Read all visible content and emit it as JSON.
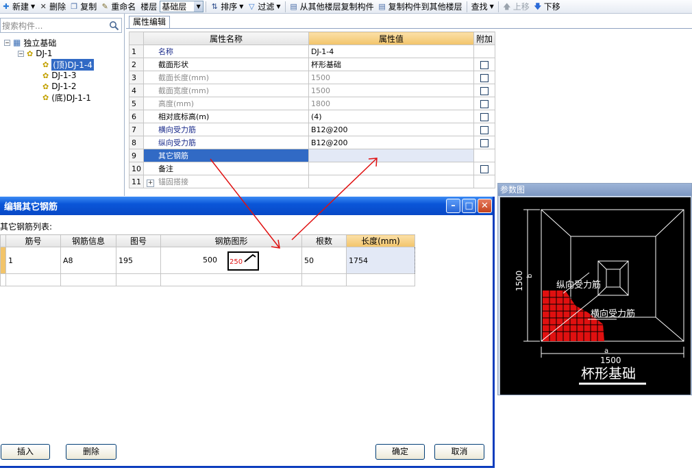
{
  "toolbar": {
    "new": "新建",
    "delete": "删除",
    "copy": "复制",
    "rename": "重命名",
    "floor_label": "楼层",
    "floor_value": "基础层",
    "sort": "排序",
    "filter": "过滤",
    "copy_from_other_floor": "从其他楼层复制构件",
    "copy_to_other_floor": "复制构件到其他楼层",
    "find": "查找",
    "move_up": "上移",
    "move_down": "下移"
  },
  "left": {
    "search_placeholder": "搜索构件...",
    "tree": {
      "root": "独立基础",
      "group": "DJ-1",
      "items": [
        "(顶)DJ-1-4",
        "DJ-1-3",
        "DJ-1-2",
        "(底)DJ-1-1"
      ]
    }
  },
  "props": {
    "tab": "属性编辑",
    "headers": {
      "name": "属性名称",
      "value": "属性值",
      "extra": "附加"
    },
    "rows": [
      {
        "n": "1",
        "name": "名称",
        "value": "DJ-1-4"
      },
      {
        "n": "2",
        "name": "截面形状",
        "value": "杯形基础"
      },
      {
        "n": "3",
        "name": "截面长度(mm)",
        "value": "1500"
      },
      {
        "n": "4",
        "name": "截面宽度(mm)",
        "value": "1500"
      },
      {
        "n": "5",
        "name": "高度(mm)",
        "value": "1800"
      },
      {
        "n": "6",
        "name": "相对底标高(m)",
        "value": "(4)"
      },
      {
        "n": "7",
        "name": "横向受力筋",
        "value": "B12@200"
      },
      {
        "n": "8",
        "name": "纵向受力筋",
        "value": "B12@200"
      },
      {
        "n": "9",
        "name": "其它钢筋",
        "value": ""
      },
      {
        "n": "10",
        "name": "备注",
        "value": ""
      },
      {
        "n": "11",
        "name": "锚固搭接",
        "value": ""
      }
    ]
  },
  "param_diagram": {
    "title": "参数图",
    "dim_vertical": "1500",
    "dim_b": "b",
    "dim_a": "a",
    "dim_horizontal": "1500",
    "label_longitudinal": "纵向受力筋",
    "label_transverse": "横向受力筋",
    "caption": "杯形基础"
  },
  "dialog": {
    "title": "编辑其它钢筋",
    "list_label": "其它钢筋列表:",
    "headers": [
      "筋号",
      "钢筋信息",
      "图号",
      "钢筋图形",
      "根数",
      "长度(mm)"
    ],
    "row": {
      "bar_no": "1",
      "info": "A8",
      "shape_no": "195",
      "shape_left": "500",
      "shape_inner": "250",
      "count": "50",
      "length": "1754"
    },
    "buttons": {
      "insert": "插入",
      "delete": "删除",
      "ok": "确定",
      "cancel": "取消"
    }
  },
  "colors": {
    "selection": "#316ac5",
    "title_bar": "#0a56d8",
    "header_highlight": "#f2c46a",
    "rebar_red": "#e01010"
  }
}
